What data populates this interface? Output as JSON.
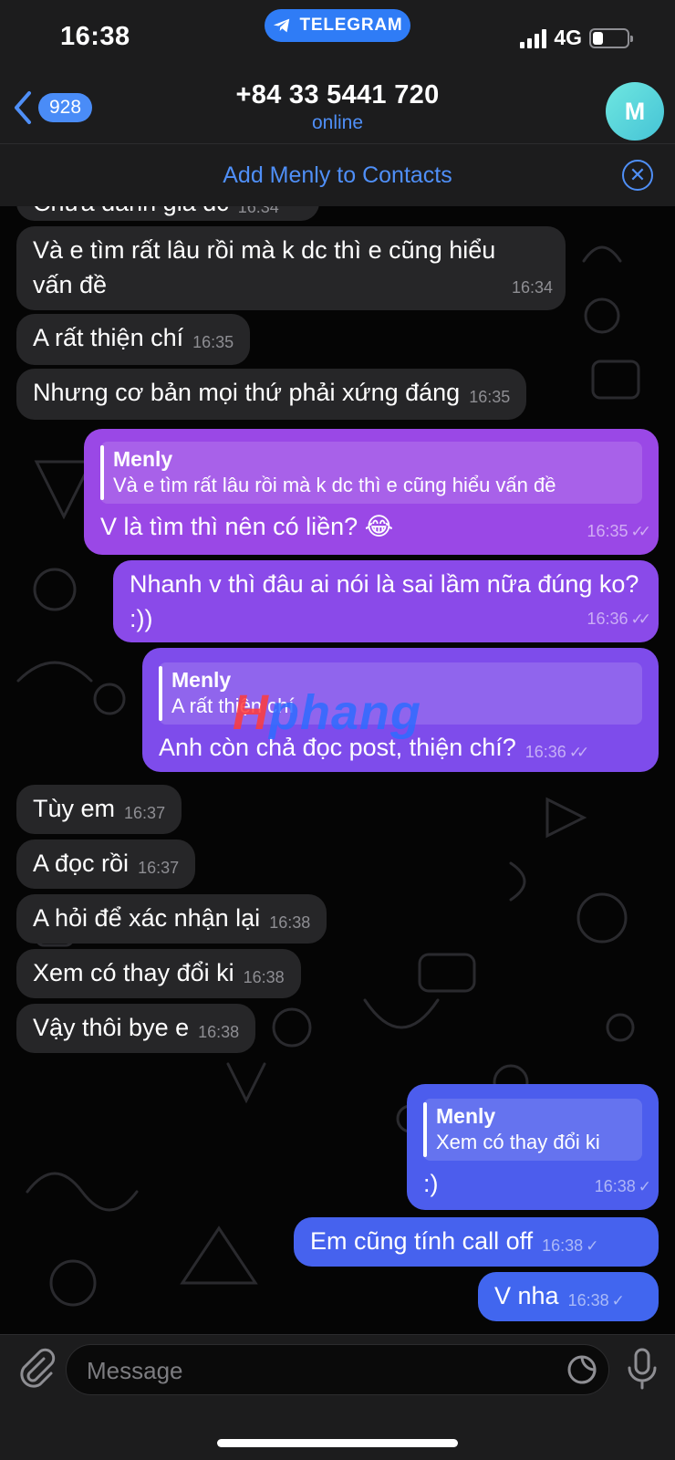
{
  "status_bar": {
    "time": "16:38",
    "app_pill": "TELEGRAM",
    "network": "4G"
  },
  "header": {
    "back_count": "928",
    "title": "+84 33 5441 720",
    "subtitle": "online",
    "avatar_letter": "M"
  },
  "contacts_bar": {
    "label": "Add Menly to Contacts"
  },
  "watermark": {
    "prefix": "H",
    "rest": "phang"
  },
  "messages": [
    {
      "text": "Chưa đánh giá dc",
      "time": "16:34"
    },
    {
      "text": "Và e tìm rất lâu rồi mà k dc thì e cũng hiểu vấn đề",
      "time": "16:34"
    },
    {
      "text": "A rất thiện chí",
      "time": "16:35"
    },
    {
      "text": "Nhưng cơ bản mọi thứ phải xứng đáng",
      "time": "16:35"
    },
    {
      "reply_name": "Menly",
      "reply_text": "Và e tìm rất lâu rồi mà k dc thì e cũng hiểu vấn đề",
      "text": "V là tìm thì nên có liền? 😂",
      "time": "16:35"
    },
    {
      "text": "Nhanh v thì đâu ai nói là sai lầm nữa đúng ko? :))",
      "time": "16:36"
    },
    {
      "reply_name": "Menly",
      "reply_text": "A rất thiện chí",
      "text": "Anh còn chả đọc post, thiện chí?",
      "time": "16:36"
    },
    {
      "text": "Tùy em",
      "time": "16:37"
    },
    {
      "text": "A đọc rồi",
      "time": "16:37"
    },
    {
      "text": "A hỏi để xác nhận lại",
      "time": "16:38"
    },
    {
      "text": "Xem có thay đổi ki",
      "time": "16:38"
    },
    {
      "text": "Vậy thôi bye e",
      "time": "16:38"
    },
    {
      "reply_name": "Menly",
      "reply_text": "Xem có thay đổi ki",
      "text": ":)",
      "time": "16:38"
    },
    {
      "text": "Em cũng tính call off",
      "time": "16:38"
    },
    {
      "text": "V nha",
      "time": "16:38"
    }
  ],
  "input": {
    "placeholder": "Message"
  },
  "colors": {
    "accent": "#4f8ff7",
    "incoming": "#262628",
    "outgoing_top": "#a24be8",
    "outgoing_bottom": "#3f63ee"
  },
  "icons": [
    "telegram-icon",
    "back-chevron-icon",
    "close-icon",
    "paperclip-icon",
    "sticker-icon",
    "microphone-icon",
    "read-check-icon"
  ]
}
